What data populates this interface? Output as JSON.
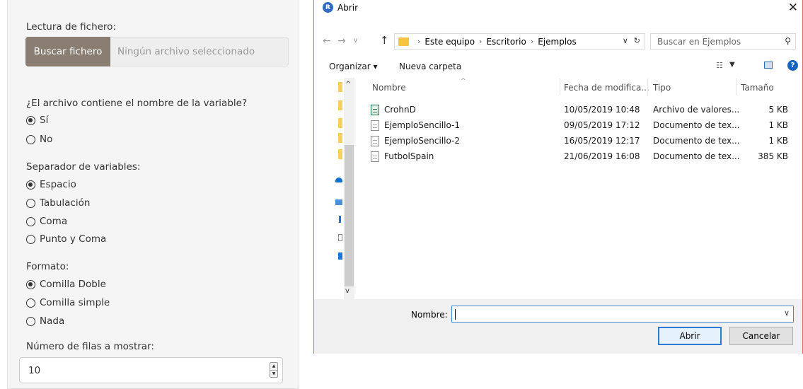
{
  "left_panel": {
    "file_label": "Lectura de fichero:",
    "browse_button": "Buscar fichero",
    "no_file_text": "Ningún archivo seleccionado",
    "header_question": "¿El archivo contiene el nombre de la variable?",
    "header_options": [
      {
        "label": "Sí",
        "selected": true
      },
      {
        "label": "No",
        "selected": false
      }
    ],
    "separator_label": "Separador de variables:",
    "separator_options": [
      {
        "label": "Espacio",
        "selected": true
      },
      {
        "label": "Tabulación",
        "selected": false
      },
      {
        "label": "Coma",
        "selected": false
      },
      {
        "label": "Punto y Coma",
        "selected": false
      }
    ],
    "format_label": "Formato:",
    "format_options": [
      {
        "label": "Comilla Doble",
        "selected": true
      },
      {
        "label": "Comilla simple",
        "selected": false
      },
      {
        "label": "Nada",
        "selected": false
      }
    ],
    "rows_label": "Número de filas a mostrar:",
    "rows_value": "10"
  },
  "dialog": {
    "title": "Abrir",
    "close_glyph": "✕",
    "breadcrumb": [
      "Este equipo",
      "Escritorio",
      "Ejemplos"
    ],
    "search_placeholder": "Buscar en Ejemplos",
    "organize": "Organizar ▾",
    "new_folder": "Nueva carpeta",
    "columns": {
      "name": "Nombre",
      "date": "Fecha de modifica...",
      "type": "Tipo",
      "size": "Tamaño"
    },
    "files": [
      {
        "name": "CrohnD",
        "date": "10/05/2019 10:48",
        "type": "Archivo de valores...",
        "size": "5 KB",
        "icon": "csv-file-icon"
      },
      {
        "name": "EjemploSencillo-1",
        "date": "09/05/2019 17:12",
        "type": "Documento de tex...",
        "size": "1 KB",
        "icon": "text-file-icon"
      },
      {
        "name": "EjemploSencillo-2",
        "date": "16/05/2019 12:17",
        "type": "Documento de tex...",
        "size": "1 KB",
        "icon": "text-file-icon"
      },
      {
        "name": "FutbolSpain",
        "date": "21/06/2019 16:08",
        "type": "Documento de tex...",
        "size": "385 KB",
        "icon": "text-file-icon"
      }
    ],
    "filename_label": "Nombre:",
    "filename_value": "",
    "open_button": "Abrir",
    "cancel_button": "Cancelar"
  }
}
